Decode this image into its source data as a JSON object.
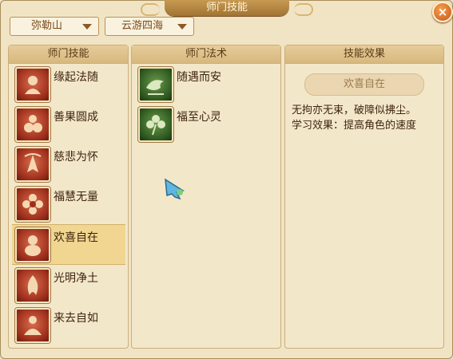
{
  "window": {
    "title": "师门技能",
    "close_symbol": "×"
  },
  "filters": {
    "school": "弥勒山",
    "region": "云游四海"
  },
  "panels": {
    "school_skills": {
      "header": "师门技能",
      "items": [
        {
          "label": "缘起法随",
          "icon": "monk-icon"
        },
        {
          "label": "善果圆成",
          "icon": "fruit-icon"
        },
        {
          "label": "慈悲为怀",
          "icon": "praying-hands-icon"
        },
        {
          "label": "福慧无量",
          "icon": "lotus-icon"
        },
        {
          "label": "欢喜自在",
          "icon": "laughing-buddha-icon"
        },
        {
          "label": "光明净土",
          "icon": "flame-icon"
        },
        {
          "label": "来去自如",
          "icon": "meditation-icon"
        }
      ],
      "selected_index": 4
    },
    "school_spells": {
      "header": "师门法术",
      "items": [
        {
          "label": "随遇而安",
          "icon": "bird-icon"
        },
        {
          "label": "福至心灵",
          "icon": "clover-icon"
        }
      ]
    },
    "skill_effect": {
      "header": "技能效果",
      "name": "欢喜自在",
      "description_line1": "无拘亦无束，破障似拂尘。",
      "description_line2": "学习效果：提高角色的速度"
    }
  },
  "colors": {
    "accent": "#a27434",
    "selected_row": "#f0d690",
    "skill_icon": "#9e2f1c",
    "spell_icon": "#2f5a22"
  }
}
